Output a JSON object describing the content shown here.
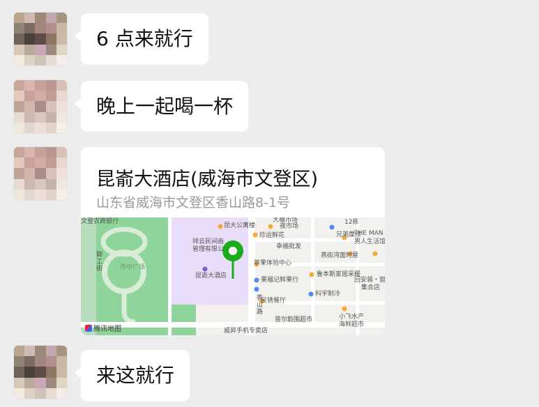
{
  "messages": [
    {
      "type": "text",
      "text": "6 点来就行"
    },
    {
      "type": "text",
      "text": "晚上一起喝一杯"
    },
    {
      "type": "location",
      "title": "昆嵛大酒店(威海市文登区)",
      "address": "山东省威海市文登区香山路8-1号",
      "map": {
        "provider": "腾讯地图",
        "pin_color": "#1aad19",
        "labels": [
          "文登农商银行",
          "昆大公寓楼",
          "大福市场",
          "夜市场",
          "12栋",
          "兄弟摩修",
          "珍运鲜花",
          "THE MAN",
          "男人生活馆",
          "祥云民间画",
          "管理有限公",
          "幸福批发",
          "市中广场",
          "燕街湾面时屋",
          "昆嵛大酒店",
          "苹果体验中心",
          "鲁本斯家居采暖",
          "回安装・窗",
          "果福记鲜果行",
          "集合店",
          "民锈餐厅",
          "科宇制冷",
          "香山路",
          "小飞水产",
          "普尔韵围超市",
          "海鲜超市",
          "威昇手机专卖店",
          "聊工街"
        ]
      }
    },
    {
      "type": "text",
      "text": "来这就行"
    }
  ],
  "colors": {
    "background": "#ededed",
    "bubble": "#ffffff",
    "pin": "#1aad19",
    "park": "#8fd49b",
    "map_bg": "#f3f1ee",
    "building": "#e9defa"
  }
}
